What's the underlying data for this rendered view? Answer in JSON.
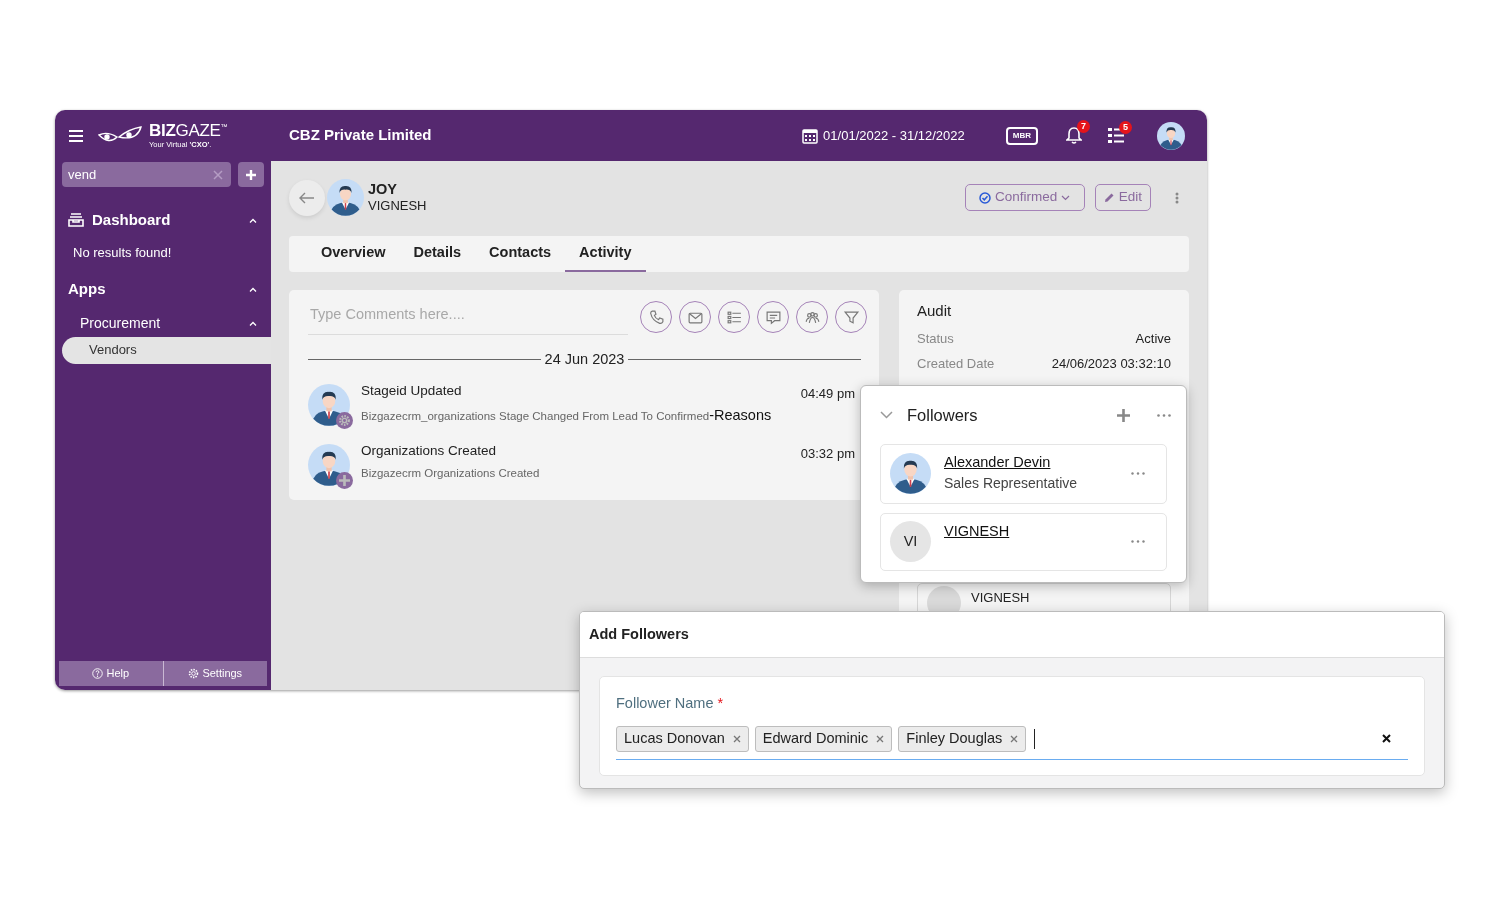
{
  "header": {
    "logo": {
      "wordmark": "**BIZ**GAZE$^{™}$",
      "tagline": "Your Virtual **'CXO'**."
    },
    "company": "CBZ Private Limited",
    "date_range": "01/01/2022 - 31/12/2022",
    "mbr": "MBR",
    "notifications_count": "7",
    "tasks_count": "5"
  },
  "sidebar": {
    "search": {
      "value": "vend"
    },
    "groups": [
      {
        "label": "Dashboard",
        "expanded": true,
        "empty_text": "No results found!"
      },
      {
        "label": "Apps",
        "expanded": true,
        "children": [
          {
            "label": "Procurement",
            "expanded": true,
            "children": [
              {
                "label": "Vendors",
                "selected": true
              }
            ]
          }
        ]
      }
    ],
    "footer": [
      {
        "label": "Help",
        "kind": "help"
      },
      {
        "label": "Settings",
        "kind": "settings"
      }
    ]
  },
  "record": {
    "name": "JOY",
    "subtitle": "VIGNESH",
    "status": "Confirmed",
    "edit": "Edit"
  },
  "tabs": [
    {
      "label": "Overview",
      "selected": false
    },
    {
      "label": "Details",
      "selected": false
    },
    {
      "label": "Contacts",
      "selected": false
    },
    {
      "label": "Activity",
      "selected": true
    }
  ],
  "activity": {
    "comment": {
      "placeholder": "Type Comments here...."
    },
    "actions": [
      {
        "kind": "phone"
      },
      {
        "kind": "mail"
      },
      {
        "kind": "list"
      },
      {
        "kind": "chat"
      },
      {
        "kind": "group"
      },
      {
        "kind": "filter"
      }
    ],
    "date": "24 Jun 2023",
    "entries": [
      {
        "kind": "update",
        "title": "Stageid Updated",
        "description": "Bizgazecrm_organizations Stage Changed From Lead To Confirmed",
        "suffix": "-Reasons",
        "time": "04:49 pm"
      },
      {
        "kind": "create",
        "title": "Organizations Created",
        "description": "Bizgazecrm Organizations Created",
        "time": "03:32 pm"
      }
    ]
  },
  "audit": {
    "title": "Audit",
    "rows": [
      {
        "label": "Status",
        "value": "Active"
      },
      {
        "label": "Created Date",
        "value": "24/06/2023 03:32:10"
      }
    ],
    "follower_card": {
      "name": "VIGNESH"
    }
  },
  "followers_popup": {
    "title": "Followers",
    "expanded": true,
    "items": [
      {
        "name": "Alexander Devin",
        "role": "Sales Representative",
        "kind": "photo"
      },
      {
        "name": "VIGNESH",
        "initials": "VI",
        "kind": "initials"
      }
    ]
  },
  "dialog": {
    "title": "Add Followers",
    "field": {
      "label": "Follower Name",
      "required_mark": "*",
      "tags": [
        "Lucas Donovan",
        "Edward Dominic",
        "Finley Douglas"
      ]
    }
  }
}
